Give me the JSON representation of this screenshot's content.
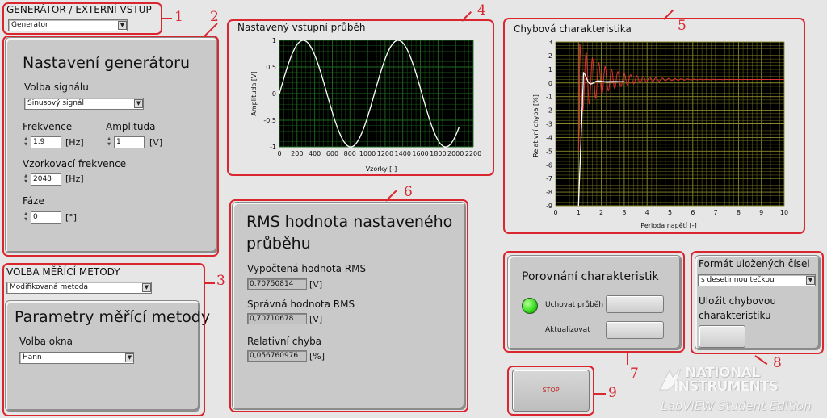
{
  "generator_section": {
    "header": "GENERÁTOR / EXTERNÍ VSTUP",
    "selector_value": "Generátor"
  },
  "generator_settings": {
    "title": "Nastavení generátoru",
    "signal_label": "Volba signálu",
    "signal_value": "Sinusový signál",
    "frequency_label": "Frekvence",
    "frequency_value": "1,9",
    "frequency_unit": "[Hz]",
    "amplitude_label": "Amplituda",
    "amplitude_value": "1",
    "amplitude_unit": "[V]",
    "sampling_label": "Vzorkovací frekvence",
    "sampling_value": "2048",
    "sampling_unit": "[Hz]",
    "phase_label": "Fáze",
    "phase_value": "0",
    "phase_unit": "[°]"
  },
  "method_section": {
    "header": "VOLBA MĚŘÍCÍ METODY",
    "method_value": "Modifikovaná metoda",
    "params_title": "Parametry měřící metody",
    "window_label": "Volba okna",
    "window_value": "Hann"
  },
  "input_chart": {
    "title": "Nastavený vstupní průběh",
    "xlabel": "Vzorky [-]",
    "ylabel": "Amplituda [V]",
    "xticks": [
      "0",
      "200",
      "400",
      "600",
      "800",
      "1000",
      "1200",
      "1400",
      "1600",
      "1800",
      "2000",
      "2200"
    ],
    "yticks": [
      "1",
      "0,5",
      "0",
      "-0,5",
      "-1"
    ]
  },
  "error_chart": {
    "title": "Chybová charakteristika",
    "xlabel": "Perioda napětí [-]",
    "ylabel": "Relativní chyba [%]",
    "xticks": [
      "0",
      "1",
      "2",
      "3",
      "4",
      "5",
      "6",
      "7",
      "8",
      "9",
      "10"
    ],
    "yticks": [
      "3",
      "2",
      "1",
      "0",
      "-1",
      "-2",
      "-3",
      "-4",
      "-5",
      "-6",
      "-7",
      "-8",
      "-9"
    ]
  },
  "rms_section": {
    "title_line1": "RMS hodnota nastaveného",
    "title_line2": "průběhu",
    "computed_label": "Vypočtená hodnota RMS",
    "computed_value": "0,70750814",
    "computed_unit": "[V]",
    "correct_label": "Správná hodnota RMS",
    "correct_value": "0,70710678",
    "correct_unit": "[V]",
    "relerr_label": "Relativní chyba",
    "relerr_value": "0,056760976",
    "relerr_unit": "[%]"
  },
  "compare_section": {
    "title": "Porovnání charakteristik",
    "keep_label": "Uchovat průběh",
    "update_label": "Aktualizovat"
  },
  "format_section": {
    "title": "Formát uložených čísel",
    "format_value": "s desetinnou tečkou",
    "save_line1": "Uložit chybovou",
    "save_line2": "charakteristiku"
  },
  "stop_label": "STOP",
  "watermark": {
    "line1": "NATIONAL",
    "line2": "INSTRUMENTS",
    "line3": "LabVIEW Student Edition"
  },
  "annotations": [
    "1",
    "2",
    "3",
    "4",
    "5",
    "6",
    "7",
    "8",
    "9"
  ],
  "colors": {
    "annotation": "#d9262f",
    "plot_background": "#000000",
    "plot_grid": "#1f6b1f",
    "error_plot_grid": "#8a8a2a",
    "input_trace": "#ffffff",
    "error_trace_red": "#e03030",
    "led_green": "#39e020"
  }
}
